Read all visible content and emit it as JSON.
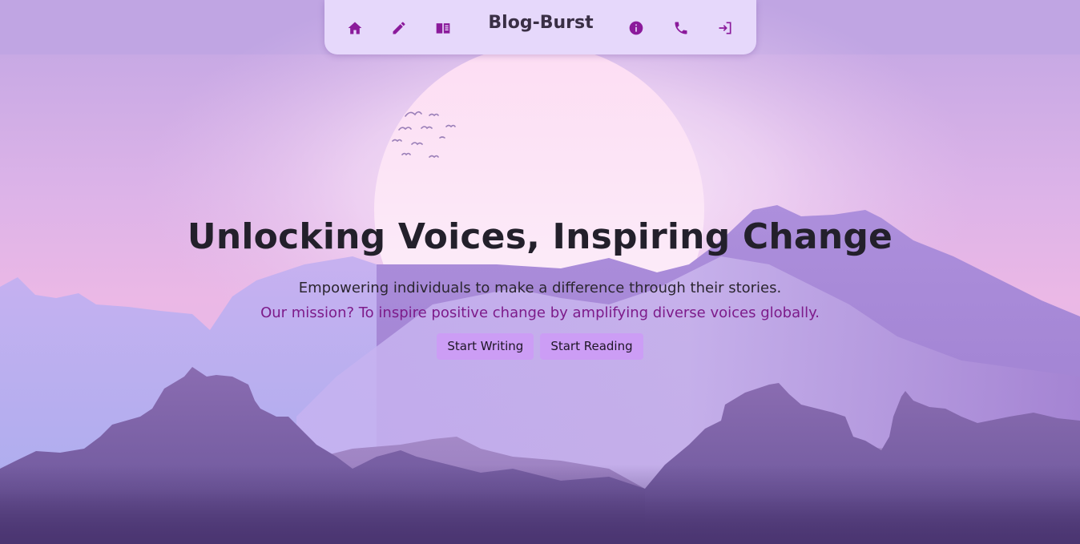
{
  "nav": {
    "brand": "Blog-Burst",
    "left_icons": [
      "home-icon",
      "pencil-icon",
      "book-icon"
    ],
    "right_icons": [
      "info-icon",
      "phone-icon",
      "login-icon"
    ],
    "icon_color": "#8b1a9b"
  },
  "hero": {
    "headline": "Unlocking Voices, Inspiring Change",
    "subline": "Empowering individuals to make a difference through their stories.",
    "mission": "Our mission? To inspire positive change by amplifying diverse voices globally.",
    "buttons": {
      "start_writing": "Start Writing",
      "start_reading": "Start Reading"
    }
  },
  "colors": {
    "sky_top": "#c1a6e4",
    "sky_pink": "#eab7e4",
    "sun": "#fbe8fb",
    "mountains_far": "#b49ae0",
    "mountains_near": "#7b62a6",
    "button_bg": "#cc9df5",
    "headline": "#23202b",
    "mission_text": "#7d1b8a"
  }
}
